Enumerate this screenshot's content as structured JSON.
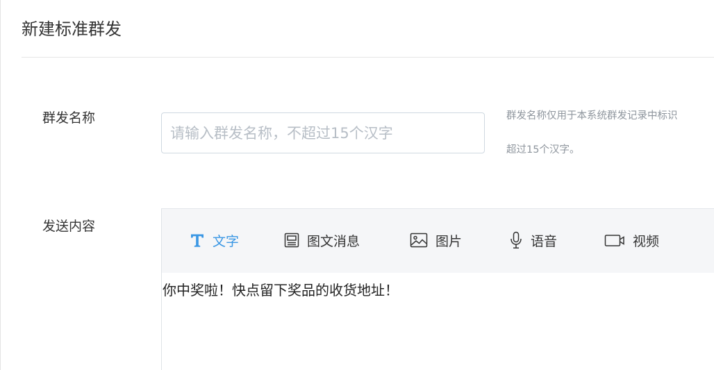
{
  "page": {
    "title": "新建标准群发"
  },
  "form": {
    "name": {
      "label": "群发名称",
      "placeholder": "请输入群发名称，不超过15个汉字",
      "value": "",
      "hint_line1": "群发名称仅用于本系统群发记录中标识",
      "hint_line2": "超过15个汉字。"
    },
    "content": {
      "label": "发送内容",
      "tabs": [
        {
          "label": "文字",
          "icon": "text-icon",
          "active": true
        },
        {
          "label": "图文消息",
          "icon": "article-icon",
          "active": false
        },
        {
          "label": "图片",
          "icon": "image-icon",
          "active": false
        },
        {
          "label": "语音",
          "icon": "microphone-icon",
          "active": false
        },
        {
          "label": "视频",
          "icon": "video-icon",
          "active": false
        }
      ],
      "text": "你中奖啦！快点留下奖品的收货地址！"
    }
  },
  "colors": {
    "accent": "#3a97e4",
    "toolbar_bg": "#f5f6f8",
    "input_border": "#cfd8e0",
    "hint_text": "#8e959d",
    "placeholder": "#b7bec6"
  }
}
